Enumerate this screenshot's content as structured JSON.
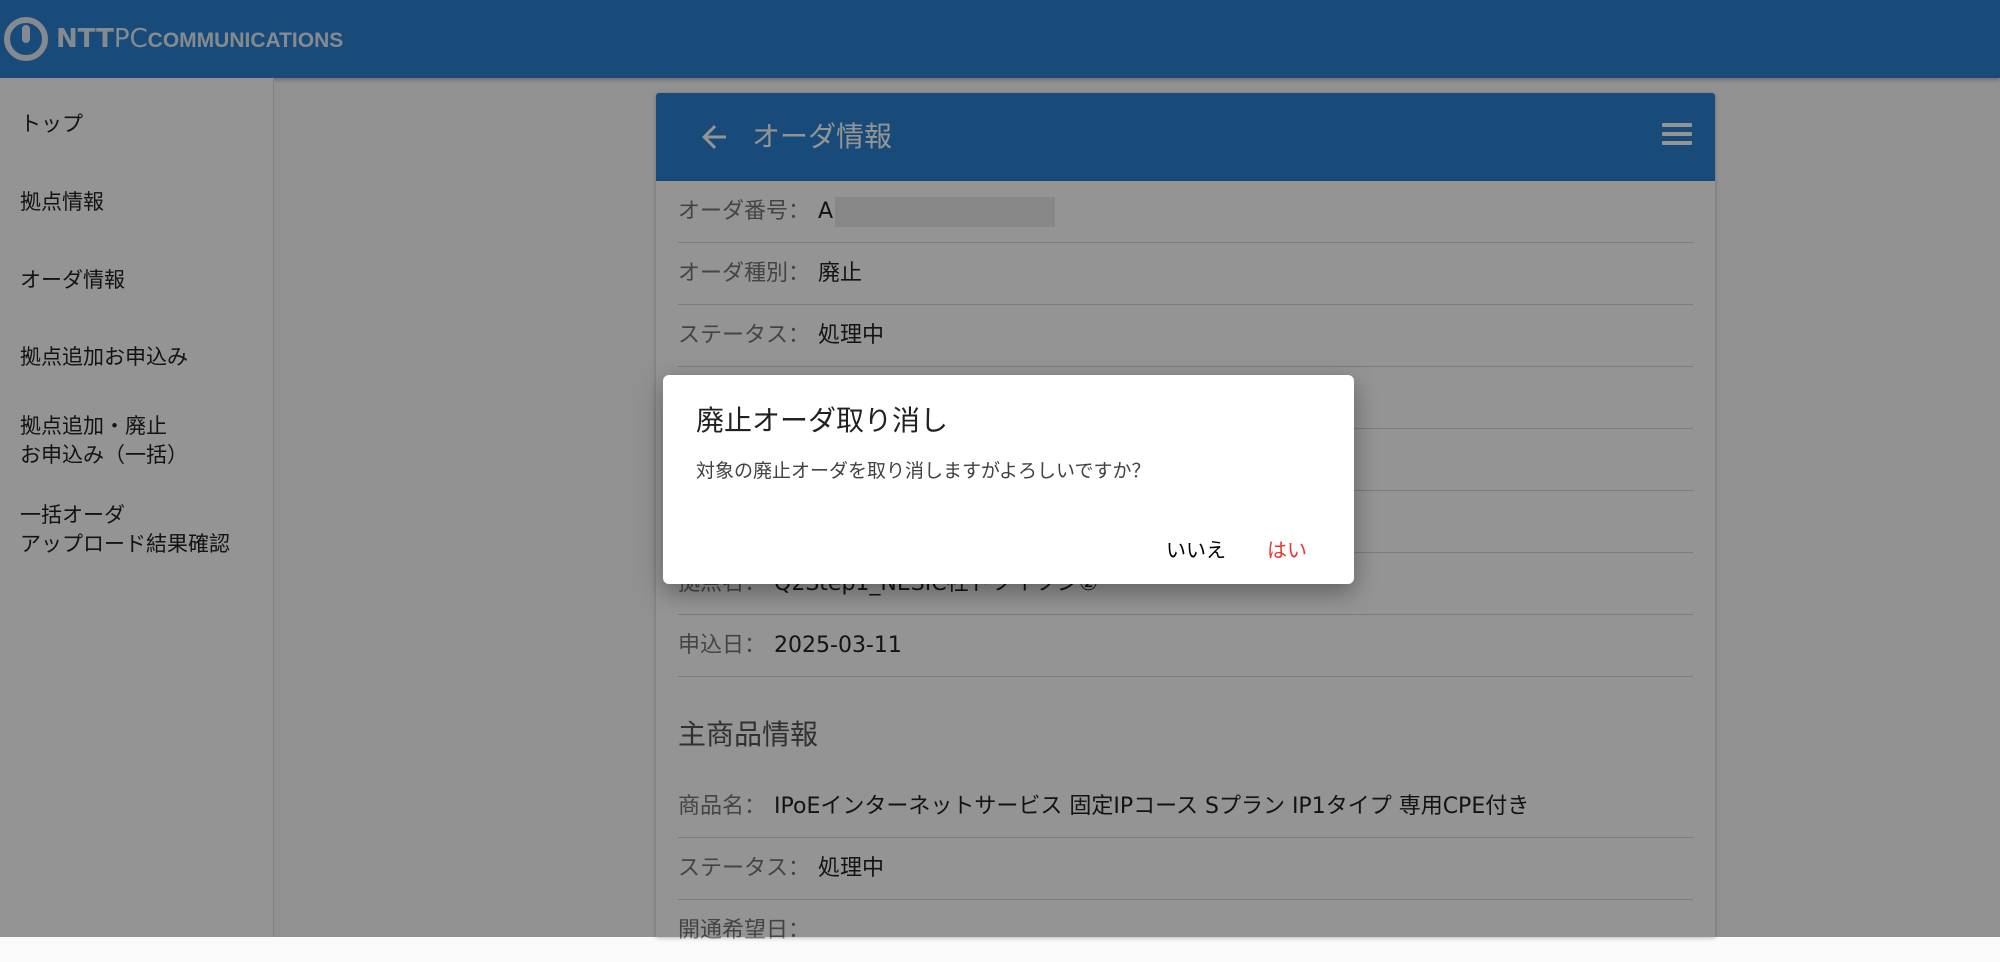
{
  "header": {
    "logo_ntt": "NTT",
    "logo_pc": "PC",
    "logo_comm": "COMMUNICATIONS"
  },
  "sidebar": {
    "items": [
      {
        "label": "トップ"
      },
      {
        "label": "拠点情報"
      },
      {
        "label": "オーダ情報"
      },
      {
        "label": "拠点追加お申込み"
      },
      {
        "label_line1": "拠点追加・廃止",
        "label_line2": "お申込み（一括）"
      },
      {
        "label_line1": "一括オーダ",
        "label_line2": "アップロード結果確認"
      }
    ]
  },
  "card": {
    "title": "オーダ情報",
    "rows": [
      {
        "key": "オーダ番号：",
        "value": "A"
      },
      {
        "key": "オーダ種別：",
        "value": "廃止"
      },
      {
        "key": "ステータス：",
        "value": "処理中"
      },
      {
        "key": "拠点名：",
        "value": "Q2Step1_NESIC社ドツイツン②"
      },
      {
        "key": "申込日：",
        "value": "2025-03-11"
      }
    ],
    "section_title": "主商品情報",
    "product_rows": [
      {
        "key": "商品名：",
        "value": "IPoEインターネットサービス 固定IPコース Sプラン IP1タイプ 専用CPE付き"
      },
      {
        "key": "ステータス：",
        "value": "処理中"
      },
      {
        "key": "開通希望日：",
        "value": ""
      }
    ]
  },
  "dialog": {
    "title": "廃止オーダ取り消し",
    "message": "対象の廃止オーダを取り消しますがよろしいですか？",
    "cancel_label": "いいえ",
    "confirm_label": "はい",
    "confirm_color": "#e53935"
  },
  "colors": {
    "primary": "#2a82d0"
  }
}
